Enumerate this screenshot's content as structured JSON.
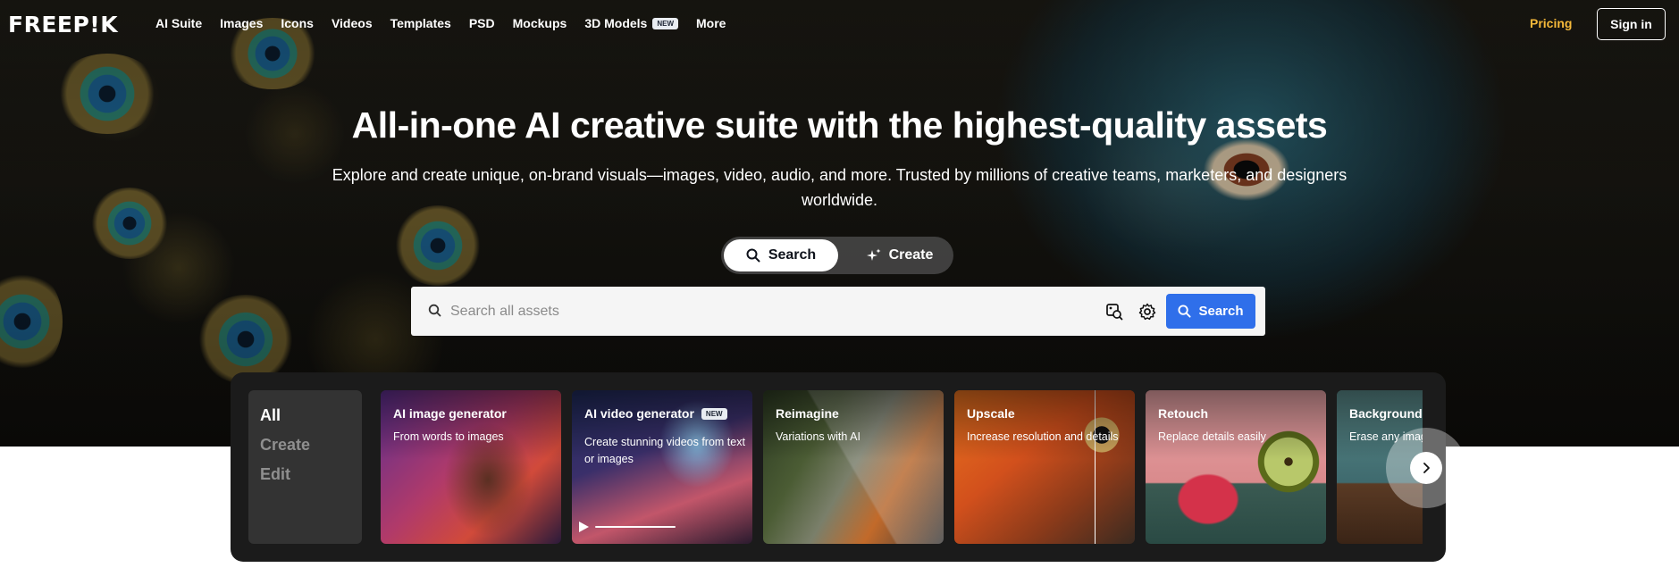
{
  "nav": {
    "logo": "FREEP!K",
    "links": [
      "AI Suite",
      "Images",
      "Icons",
      "Videos",
      "Templates",
      "PSD",
      "Mockups",
      "3D Models",
      "More"
    ],
    "new_badge": "NEW",
    "pricing": "Pricing",
    "signin": "Sign in",
    "pricing_color": "#f5b93a"
  },
  "hero": {
    "headline": "All-in-one AI creative suite with the highest-quality assets",
    "subtitle": "Explore and create unique, on-brand visuals—images, video, audio, and more. Trusted by millions of creative teams, marketers, and designers worldwide."
  },
  "mode_toggle": {
    "search_label": "Search",
    "create_label": "Create",
    "selected": "Search"
  },
  "search": {
    "placeholder": "Search all assets",
    "value": "",
    "button_label": "Search",
    "button_color": "#2f6fea",
    "icons": [
      "search-icon",
      "image-search-icon",
      "gear-icon"
    ]
  },
  "tools": {
    "categories": [
      {
        "label": "All",
        "active": true
      },
      {
        "label": "Create",
        "active": false
      },
      {
        "label": "Edit",
        "active": false
      }
    ],
    "cards": [
      {
        "title": "AI image generator",
        "desc": "From words to images",
        "badge": ""
      },
      {
        "title": "AI video generator",
        "desc": "Create stunning videos from text or images",
        "badge": "NEW"
      },
      {
        "title": "Reimagine",
        "desc": "Variations with AI",
        "badge": ""
      },
      {
        "title": "Upscale",
        "desc": "Increase resolution and details",
        "badge": ""
      },
      {
        "title": "Retouch",
        "desc": "Replace details easily",
        "badge": ""
      },
      {
        "title": "Background R",
        "desc": "Erase any imag",
        "badge": ""
      }
    ],
    "next_icon": "chevron-right-icon"
  }
}
